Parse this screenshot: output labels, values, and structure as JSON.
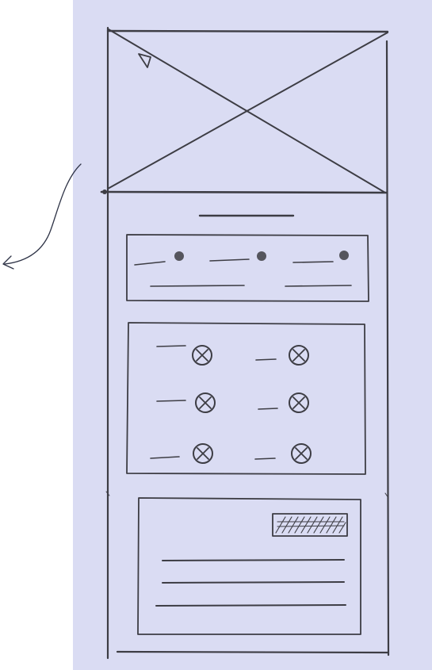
{
  "colors": {
    "background": "#ffffff",
    "panel": "#dadcf3",
    "pencil": "#3d3d44",
    "arrow_ink": "#2f3447"
  },
  "wireframe": {
    "option_rows": 1,
    "options_per_row": 3,
    "checkbox_rows": 3,
    "checkbox_columns": 2,
    "text_lines": 3
  },
  "icons": {
    "hero_image": "image-placeholder-cross",
    "play": "play-triangle-icon",
    "radio": "radio-dot-icon",
    "checkbox": "checkbox-x-icon",
    "button": "hatched-button",
    "arrow": "curved-arrow-icon"
  }
}
